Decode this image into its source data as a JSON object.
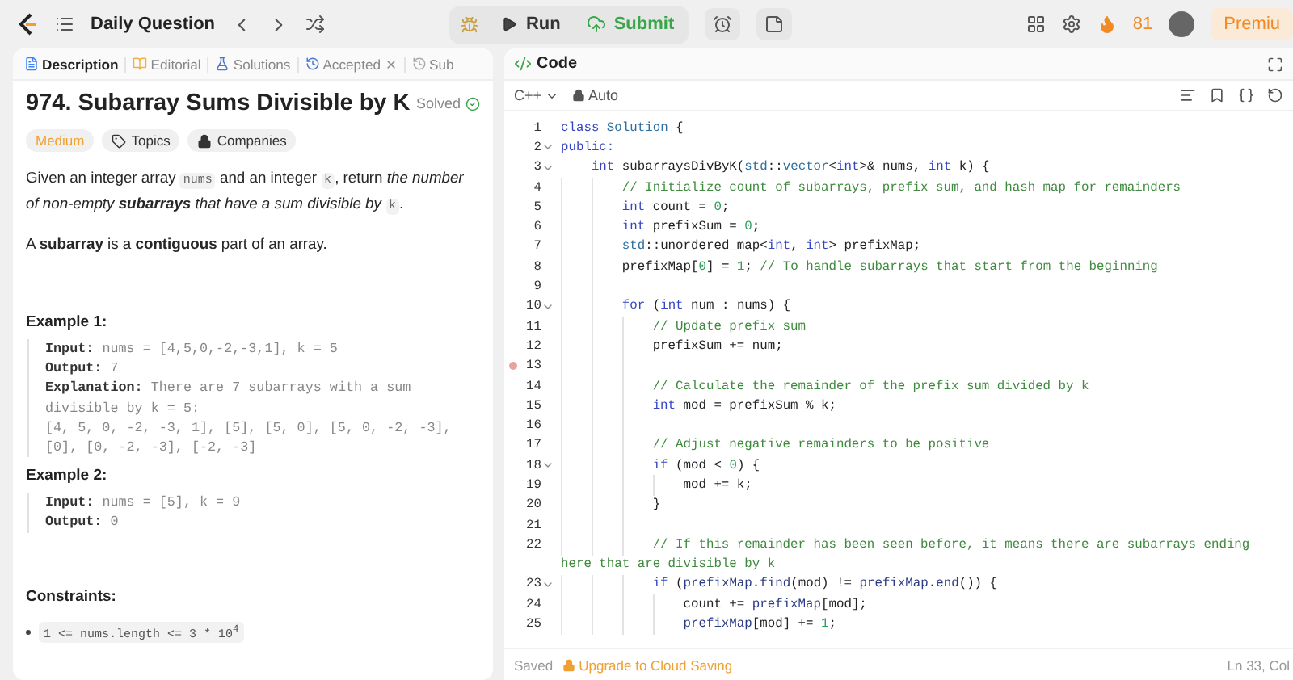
{
  "topbar": {
    "nav_title": "Daily Question",
    "run": "Run",
    "submit": "Submit",
    "streak": "81",
    "premium": "Premiu"
  },
  "left_tabs": [
    {
      "label": "Description",
      "selected": true,
      "closable": false
    },
    {
      "label": "Editorial",
      "selected": false,
      "closable": false
    },
    {
      "label": "Solutions",
      "selected": false,
      "closable": false
    },
    {
      "label": "Accepted",
      "selected": false,
      "closable": true
    },
    {
      "label": "Sub",
      "selected": false,
      "closable": false
    }
  ],
  "problem": {
    "title": "974. Subarray Sums Divisible by K",
    "status": "Solved",
    "difficulty": "Medium",
    "tags": [
      "Topics",
      "Companies"
    ],
    "paragraphs": [
      [
        {
          "kind": "text",
          "text": "Given an integer array "
        },
        {
          "kind": "code",
          "text": "nums"
        },
        {
          "kind": "text",
          "text": " and an integer "
        },
        {
          "kind": "code",
          "text": "k"
        },
        {
          "kind": "text",
          "text": ", return "
        },
        {
          "kind": "italic",
          "text": "the number of non-empty "
        },
        {
          "kind": "bolditalic",
          "text": "subarrays"
        },
        {
          "kind": "italic",
          "text": " that have a sum divisible by "
        },
        {
          "kind": "code",
          "text": "k"
        },
        {
          "kind": "text",
          "text": "."
        }
      ],
      [
        {
          "kind": "text",
          "text": "A "
        },
        {
          "kind": "bold",
          "text": "subarray"
        },
        {
          "kind": "text",
          "text": " is a "
        },
        {
          "kind": "bold",
          "text": "contiguous"
        },
        {
          "kind": "text",
          "text": " part of an array."
        }
      ]
    ],
    "examples": [
      {
        "title": "Example 1:",
        "lines": [
          {
            "label": "Input:",
            "text": "nums = [4,5,0,-2,-3,1], k = 5"
          },
          {
            "label": "Output:",
            "text": "7"
          },
          {
            "label": "Explanation:",
            "text": "There are 7 subarrays with a sum"
          },
          {
            "text": "divisible by k = 5:"
          },
          {
            "text": "[4, 5, 0, -2, -3, 1], [5], [5, 0], [5, 0, -2, -3],"
          },
          {
            "text": "[0], [0, -2, -3], [-2, -3]"
          }
        ]
      },
      {
        "title": "Example 2:",
        "lines": [
          {
            "label": "Input:",
            "text": "nums = [5], k = 9"
          },
          {
            "label": "Output:",
            "text": "0"
          }
        ]
      }
    ],
    "constraints_title": "Constraints:",
    "constraints": [
      "1 <= nums.length <= 3 * 10$^{4}$"
    ]
  },
  "code_panel": {
    "title": "Code",
    "language": "C++",
    "mode": "Auto",
    "lines": [
      {
        "n": "1",
        "breakpoint": false,
        "segs": [
          {
            "kind": "keyword",
            "text": "class"
          },
          {
            "kind": "type",
            "text": " Solution"
          },
          {
            "kind": "plain",
            "text": " {"
          }
        ]
      },
      {
        "n": "2",
        "breakpoint": false,
        "segs": [
          {
            "kind": "keyword",
            "text": "public:"
          }
        ],
        "children": [
          {
            "n": "3",
            "breakpoint": false,
            "segs": [
              {
                "kind": "keyword",
                "text": "int"
              },
              {
                "kind": "plain",
                "text": " subarraysDivByK("
              },
              {
                "kind": "type",
                "text": "std"
              },
              {
                "kind": "plain",
                "text": "::"
              },
              {
                "kind": "type",
                "text": "vector"
              },
              {
                "kind": "plain",
                "text": "<"
              },
              {
                "kind": "keyword",
                "text": "int"
              },
              {
                "kind": "plain",
                "text": ">& nums, "
              },
              {
                "kind": "keyword",
                "text": "int"
              },
              {
                "kind": "plain",
                "text": " k) {"
              }
            ],
            "children": [
              {
                "n": "4",
                "breakpoint": false,
                "segs": [
                  {
                    "kind": "comment",
                    "text": "// Initialize count of subarrays, prefix sum, and hash map for remainders"
                  }
                ]
              },
              {
                "n": "5",
                "breakpoint": false,
                "segs": [
                  {
                    "kind": "keyword",
                    "text": "int"
                  },
                  {
                    "kind": "plain",
                    "text": " count = "
                  },
                  {
                    "kind": "number",
                    "text": "0"
                  },
                  {
                    "kind": "plain",
                    "text": ";"
                  }
                ]
              },
              {
                "n": "6",
                "breakpoint": false,
                "segs": [
                  {
                    "kind": "keyword",
                    "text": "int"
                  },
                  {
                    "kind": "plain",
                    "text": " prefixSum = "
                  },
                  {
                    "kind": "number",
                    "text": "0"
                  },
                  {
                    "kind": "plain",
                    "text": ";"
                  }
                ]
              },
              {
                "n": "7",
                "breakpoint": false,
                "segs": [
                  {
                    "kind": "type",
                    "text": "std"
                  },
                  {
                    "kind": "plain",
                    "text": "::unordered_map<"
                  },
                  {
                    "kind": "keyword",
                    "text": "int"
                  },
                  {
                    "kind": "plain",
                    "text": ", "
                  },
                  {
                    "kind": "keyword",
                    "text": "int"
                  },
                  {
                    "kind": "plain",
                    "text": "> prefixMap;"
                  }
                ]
              },
              {
                "n": "8",
                "breakpoint": false,
                "segs": [
                  {
                    "kind": "plain",
                    "text": "prefixMap["
                  },
                  {
                    "kind": "number",
                    "text": "0"
                  },
                  {
                    "kind": "plain",
                    "text": "] = "
                  },
                  {
                    "kind": "number",
                    "text": "1"
                  },
                  {
                    "kind": "plain",
                    "text": ";"
                  },
                  {
                    "kind": "comment",
                    "text": " // To handle subarrays that start from the beginning"
                  }
                ]
              },
              {
                "n": "9",
                "breakpoint": false
              },
              {
                "n": "10",
                "breakpoint": false,
                "segs": [
                  {
                    "kind": "keyword",
                    "text": "for"
                  },
                  {
                    "kind": "plain",
                    "text": " ("
                  },
                  {
                    "kind": "keyword",
                    "text": "int"
                  },
                  {
                    "kind": "plain",
                    "text": " num : nums) {"
                  }
                ],
                "children": [
                  {
                    "n": "11",
                    "breakpoint": false,
                    "segs": [
                      {
                        "kind": "comment",
                        "text": "// Update prefix sum"
                      }
                    ]
                  },
                  {
                    "n": "12",
                    "breakpoint": false,
                    "segs": [
                      {
                        "kind": "plain",
                        "text": "prefixSum += num;"
                      }
                    ]
                  },
                  {
                    "n": "13",
                    "breakpoint": true
                  },
                  {
                    "n": "14",
                    "breakpoint": false,
                    "segs": [
                      {
                        "kind": "comment",
                        "text": "// Calculate the remainder of the prefix sum divided by k"
                      }
                    ]
                  },
                  {
                    "n": "15",
                    "breakpoint": false,
                    "segs": [
                      {
                        "kind": "keyword",
                        "text": "int"
                      },
                      {
                        "kind": "plain",
                        "text": " mod = prefixSum % k;"
                      }
                    ]
                  },
                  {
                    "n": "16",
                    "breakpoint": false
                  },
                  {
                    "n": "17",
                    "breakpoint": false,
                    "segs": [
                      {
                        "kind": "comment",
                        "text": "// Adjust negative remainders to be positive"
                      }
                    ]
                  },
                  {
                    "n": "18",
                    "breakpoint": false,
                    "segs": [
                      {
                        "kind": "keyword",
                        "text": "if"
                      },
                      {
                        "kind": "plain",
                        "text": " (mod < "
                      },
                      {
                        "kind": "number",
                        "text": "0"
                      },
                      {
                        "kind": "plain",
                        "text": ") {"
                      }
                    ],
                    "children": [
                      {
                        "n": "19",
                        "breakpoint": false,
                        "segs": [
                          {
                            "kind": "plain",
                            "text": "mod += k;"
                          }
                        ]
                      }
                    ]
                  },
                  {
                    "n": "20",
                    "breakpoint": false,
                    "segs": [
                      {
                        "kind": "plain",
                        "text": "}"
                      }
                    ]
                  },
                  {
                    "n": "21",
                    "breakpoint": false
                  },
                  {
                    "n": "22",
                    "breakpoint": false,
                    "segs": [
                      {
                        "kind": "comment",
                        "text": "// If this remainder has been seen before, it means there are subarrays ending"
                      }
                    ],
                    "wrap": "here that are divisible by k"
                  },
                  {
                    "n": "23",
                    "breakpoint": false,
                    "segs": [
                      {
                        "kind": "keyword",
                        "text": "if"
                      },
                      {
                        "kind": "plain",
                        "text": " ("
                      },
                      {
                        "kind": "function",
                        "text": "prefixMap"
                      },
                      {
                        "kind": "plain",
                        "text": "."
                      },
                      {
                        "kind": "function",
                        "text": "find"
                      },
                      {
                        "kind": "plain",
                        "text": "(mod) != "
                      },
                      {
                        "kind": "function",
                        "text": "prefixMap"
                      },
                      {
                        "kind": "plain",
                        "text": "."
                      },
                      {
                        "kind": "function",
                        "text": "end"
                      },
                      {
                        "kind": "plain",
                        "text": "()) {"
                      }
                    ],
                    "children": [
                      {
                        "n": "24",
                        "breakpoint": false,
                        "segs": [
                          {
                            "kind": "plain",
                            "text": "count += "
                          },
                          {
                            "kind": "function",
                            "text": "prefixMap"
                          },
                          {
                            "kind": "plain",
                            "text": "[mod];"
                          }
                        ]
                      },
                      {
                        "n": "25",
                        "breakpoint": false,
                        "segs": [
                          {
                            "kind": "function",
                            "text": "prefixMap"
                          },
                          {
                            "kind": "plain",
                            "text": "[mod] += "
                          },
                          {
                            "kind": "number",
                            "text": "1"
                          },
                          {
                            "kind": "plain",
                            "text": ";"
                          }
                        ]
                      }
                    ]
                  }
                ]
              }
            ]
          }
        ]
      }
    ],
    "footer": {
      "saved": "Saved",
      "upgrade": "Upgrade to Cloud Saving",
      "position": "Ln 33, Col"
    }
  }
}
